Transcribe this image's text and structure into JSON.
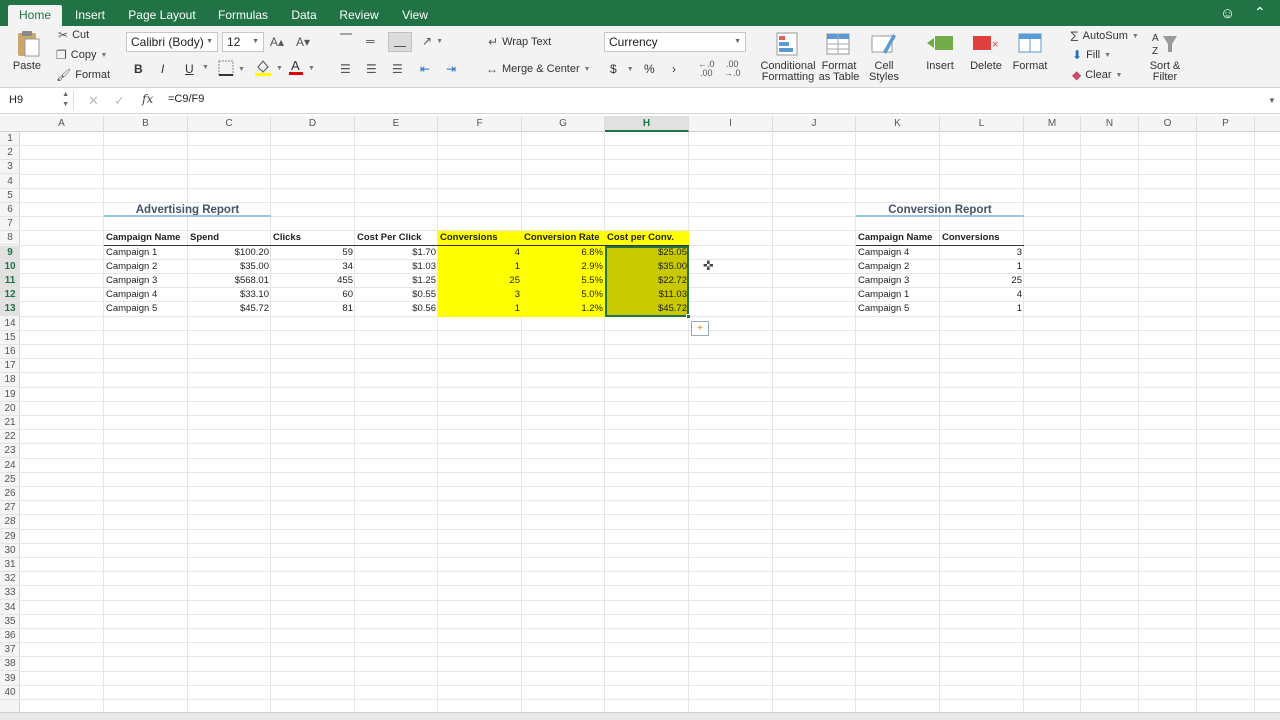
{
  "tabs": [
    {
      "label": "Home",
      "active": true
    },
    {
      "label": "Insert"
    },
    {
      "label": "Page Layout"
    },
    {
      "label": "Formulas"
    },
    {
      "label": "Data"
    },
    {
      "label": "Review"
    },
    {
      "label": "View"
    }
  ],
  "ribbon": {
    "paste": "Paste",
    "cut": "Cut",
    "copy": "Copy",
    "format_painter": "Format",
    "font_name": "Calibri (Body)",
    "font_size": "12",
    "bold": "B",
    "italic": "I",
    "underline": "U",
    "wrap_text": "Wrap Text",
    "merge_center": "Merge & Center",
    "number_format": "Currency",
    "currency_symbol": "$",
    "percent_symbol": "%",
    "comma_symbol": "›",
    "conditional_formatting": [
      "Conditional",
      "Formatting"
    ],
    "format_as_table": [
      "Format",
      "as Table"
    ],
    "cell_styles": [
      "Cell",
      "Styles"
    ],
    "insert": "Insert",
    "delete": "Delete",
    "format": "Format",
    "autosum": "AutoSum",
    "fill": "Fill",
    "clear": "Clear",
    "sort_filter": [
      "Sort &",
      "Filter"
    ]
  },
  "formula_bar": {
    "name_box": "H9",
    "fx": "fx",
    "formula": "=C9/F9"
  },
  "columns": [
    "A",
    "B",
    "C",
    "D",
    "E",
    "F",
    "G",
    "H",
    "I",
    "J",
    "K",
    "L",
    "M",
    "N",
    "O",
    "P"
  ],
  "selected_column": "H",
  "rows": [
    "1",
    "2",
    "3",
    "4",
    "5",
    "6",
    "7",
    "8",
    "9",
    "10",
    "11",
    "12",
    "13",
    "14",
    "15",
    "16",
    "17",
    "18",
    "19",
    "20",
    "21",
    "22",
    "23",
    "24",
    "25",
    "26",
    "27",
    "28",
    "29",
    "30",
    "31",
    "32",
    "33",
    "34",
    "35",
    "36",
    "37",
    "38",
    "39",
    "40"
  ],
  "selected_rows": [
    "9",
    "10",
    "11",
    "12",
    "13"
  ],
  "advertising_report": {
    "title": "Advertising Report",
    "headers": [
      "Campaign Name",
      "Spend",
      "Clicks",
      "Cost Per Click",
      "Conversions",
      "Conversion Rate",
      "Cost per Conv."
    ],
    "rows": [
      [
        "Campaign 1",
        "$100.20",
        "59",
        "$1.70",
        "4",
        "6.8%",
        "$25.05"
      ],
      [
        "Campaign 2",
        "$35.00",
        "34",
        "$1.03",
        "1",
        "2.9%",
        "$35.00"
      ],
      [
        "Campaign 3",
        "$568.01",
        "455",
        "$1.25",
        "25",
        "5.5%",
        "$22.72"
      ],
      [
        "Campaign 4",
        "$33.10",
        "60",
        "$0.55",
        "3",
        "5.0%",
        "$11.03"
      ],
      [
        "Campaign 5",
        "$45.72",
        "81",
        "$0.56",
        "1",
        "1.2%",
        "$45.72"
      ]
    ]
  },
  "conversion_report": {
    "title": "Conversion Report",
    "headers": [
      "Campaign Name",
      "Conversions"
    ],
    "rows": [
      [
        "Campaign 4",
        "3"
      ],
      [
        "Campaign 2",
        "1"
      ],
      [
        "Campaign 3",
        "25"
      ],
      [
        "Campaign 1",
        "4"
      ],
      [
        "Campaign 5",
        "1"
      ]
    ]
  },
  "colors": {
    "accent": "#217346",
    "highlight": "#ffff00",
    "selected_fill": "#c9c900",
    "title_text": "#44546a",
    "title_underline": "#9dc3e6"
  }
}
